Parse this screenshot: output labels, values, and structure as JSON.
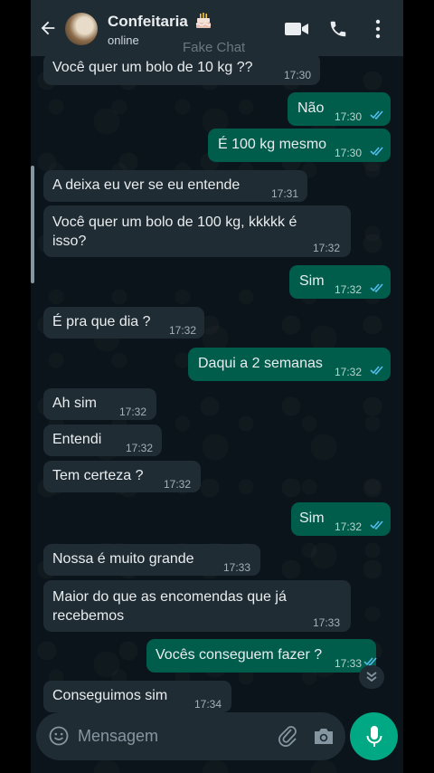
{
  "header": {
    "contact_name": "Confeitaria",
    "status": "online",
    "watermark": "Fake Chat"
  },
  "messages": [
    {
      "direction": "in",
      "text": "Você quer um bolo de 10  kg ??",
      "time": "17:30"
    },
    {
      "direction": "out",
      "text": "Não",
      "time": "17:30",
      "read": true
    },
    {
      "direction": "out",
      "text": "É 100 kg mesmo",
      "time": "17:30",
      "read": true
    },
    {
      "direction": "in",
      "text": "A deixa eu ver se eu entende",
      "time": "17:31"
    },
    {
      "direction": "in",
      "text": "Você quer um bolo de 100 kg, kkkkk é isso?",
      "time": "17:32"
    },
    {
      "direction": "out",
      "text": "Sim",
      "time": "17:32",
      "read": true
    },
    {
      "direction": "in",
      "text": "É pra que dia ?",
      "time": "17:32"
    },
    {
      "direction": "out",
      "text": "Daqui a 2 semanas",
      "time": "17:32",
      "read": true
    },
    {
      "direction": "in",
      "text": "Ah sim",
      "time": "17:32"
    },
    {
      "direction": "in",
      "text": "Entendi",
      "time": "17:32"
    },
    {
      "direction": "in",
      "text": "Tem certeza ?",
      "time": "17:32"
    },
    {
      "direction": "out",
      "text": "Sim",
      "time": "17:32",
      "read": true
    },
    {
      "direction": "in",
      "text": "Nossa é muito grande",
      "time": "17:33"
    },
    {
      "direction": "in",
      "text": "Maior do que as encomendas que já recebemos",
      "time": "17:33"
    },
    {
      "direction": "out",
      "text": "Vocês conseguem fazer ?",
      "time": "17:33",
      "read": true
    },
    {
      "direction": "in",
      "text": "Conseguimos sim",
      "time": "17:34"
    }
  ],
  "composer": {
    "placeholder": "Mensagem"
  },
  "icons": [
    "back-arrow-icon",
    "cake-icon",
    "video-call-icon",
    "phone-icon",
    "more-options-icon",
    "read-receipt-icon",
    "chevron-down-icon",
    "emoji-icon",
    "attach-icon",
    "camera-icon",
    "mic-icon"
  ],
  "colors": {
    "background": "#0b141a",
    "header": "#1f2c34",
    "incoming_bubble": "#202c33",
    "outgoing_bubble": "#005c4b",
    "accent": "#00a884",
    "read_tick": "#53bdeb"
  }
}
